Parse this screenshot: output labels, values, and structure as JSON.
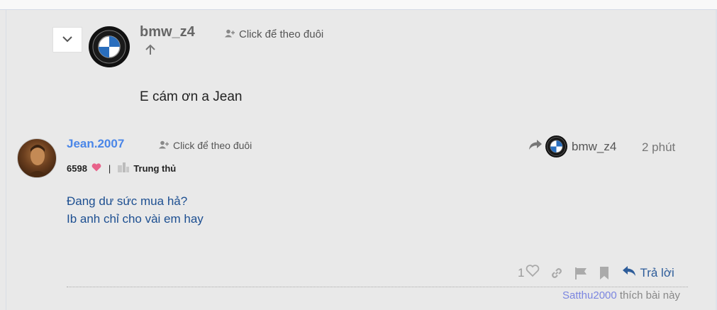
{
  "quoted_post": {
    "username": "bmw_z4",
    "follow_label": "Click để theo đuôi",
    "body": "E cám ơn a Jean"
  },
  "post": {
    "username": "Jean.2007",
    "follow_label": "Click để theo đuôi",
    "likes": "6598",
    "badge": "Trung thủ",
    "reply_to": "bmw_z4",
    "time": "2 phút",
    "body_lines": [
      "Đang dư sức mua hả?",
      "Ib anh chỉ cho vài em hay"
    ],
    "like_count": "1",
    "reply_label": "Trả lời",
    "liker": "Satthu2000",
    "liked_text": "thích bài này"
  },
  "icons": {
    "collapse": "chevron-down-icon",
    "follow": "user-plus-icon",
    "scroll_up": "arrow-up-icon",
    "heart": "heart-icon",
    "badge": "badge-icon",
    "reply_to": "share-arrow-icon",
    "like": "heart-outline-icon",
    "link": "link-icon",
    "flag": "flag-icon",
    "bookmark": "bookmark-icon",
    "reply": "reply-icon"
  },
  "colors": {
    "username_link": "#4a86e8",
    "post_text": "#1d4f91",
    "heart": "#e8628a",
    "reply_action": "#2e5d9a",
    "liker": "#7b86e0"
  }
}
